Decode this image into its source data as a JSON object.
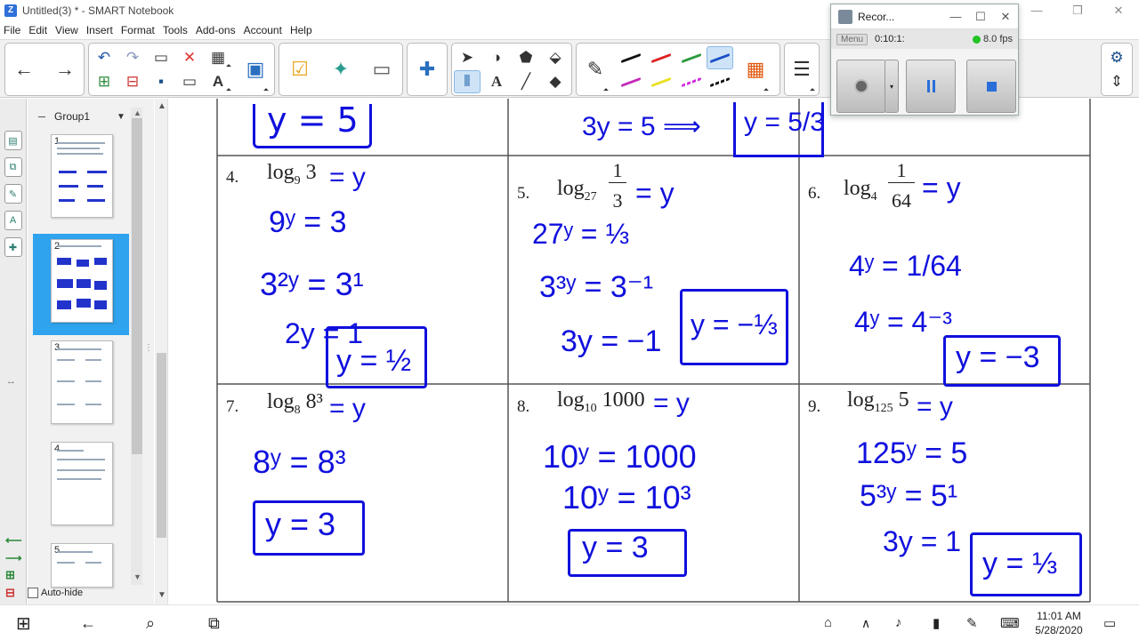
{
  "window": {
    "title": "Untitled(3) * - SMART Notebook",
    "app_icon": "Z"
  },
  "menu": [
    "File",
    "Edit",
    "View",
    "Insert",
    "Format",
    "Tools",
    "Add-ons",
    "Account",
    "Help"
  ],
  "recorder": {
    "title": "Recor...",
    "menu_label": "Menu",
    "time": "0:10:1:",
    "fps": "8.0 fps"
  },
  "sorter": {
    "group_label": "Group1",
    "pages": [
      "1",
      "2",
      "3",
      "4",
      "5"
    ],
    "selected_page": "2",
    "autohide_label": "Auto-hide"
  },
  "problems": [
    {
      "number": "4.",
      "base": "9",
      "arg": "3",
      "work": [
        "9ʸ = 3",
        "3²ʸ = 3¹",
        "2y = 1"
      ],
      "answer": "y = ½"
    },
    {
      "number": "5.",
      "base": "27",
      "arg_num": "1",
      "arg_den": "3",
      "work": [
        "27ʸ = ⅓",
        "3³ʸ = 3⁻¹",
        "3y = −1"
      ],
      "answer": "y = −⅓"
    },
    {
      "number": "6.",
      "base": "4",
      "arg_num": "1",
      "arg_den": "64",
      "work": [
        "4ʸ = 1/64",
        "4ʸ = 4⁻³"
      ],
      "answer": "y = −3"
    },
    {
      "number": "7.",
      "base": "8",
      "arg": "8³",
      "work": [
        "8ʸ = 8³"
      ],
      "answer": "y = 3"
    },
    {
      "number": "8.",
      "base": "10",
      "arg": "1000",
      "work": [
        "10ʸ = 1000",
        "10ʸ = 10³"
      ],
      "answer": "y = 3"
    },
    {
      "number": "9.",
      "base": "125",
      "arg": "5",
      "work": [
        "125ʸ = 5",
        "5³ʸ = 5¹",
        "3y = 1"
      ],
      "answer": "y = ⅓"
    }
  ],
  "top_row": {
    "left_answer": "y = 5",
    "mid_work": "3y = 5 ⟹",
    "mid_answer": "y = 5/3"
  },
  "taskbar": {
    "time": "11:01 AM",
    "date": "5/28/2020"
  },
  "colors": {
    "ink": "#1010dd",
    "grid": "#555555",
    "selected_thumb": "#2fa3ee"
  }
}
